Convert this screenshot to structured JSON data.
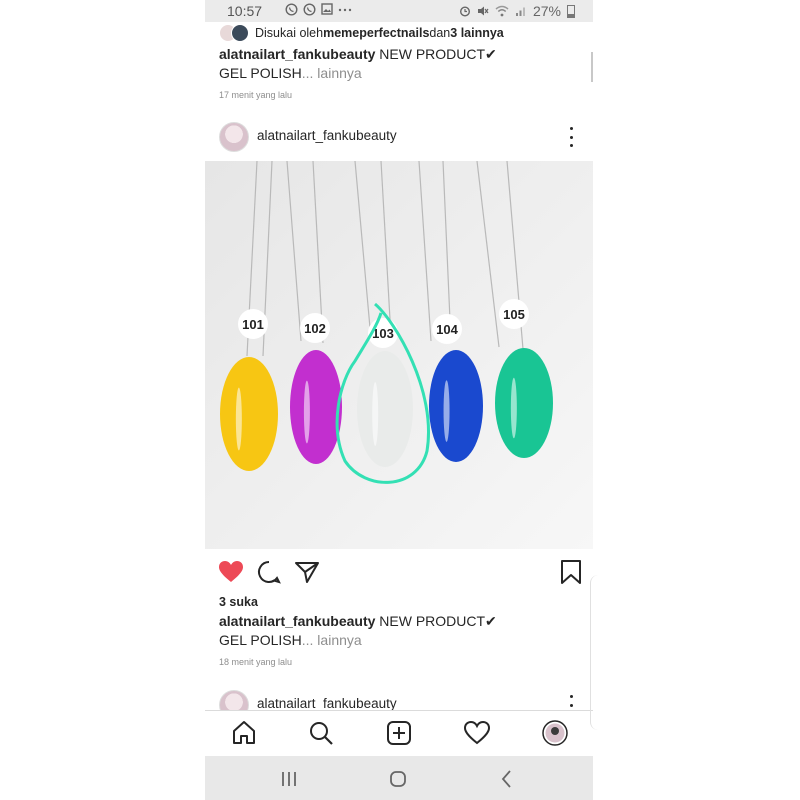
{
  "status_bar": {
    "time": "10:57",
    "battery": "27%",
    "icons_left": [
      "whatsapp-icon",
      "whatsapp-icon",
      "gallery-icon",
      "more-dots-icon"
    ],
    "icons_right": [
      "alarm-icon",
      "mute-icon",
      "wifi-icon",
      "signal-icon",
      "battery-icon"
    ]
  },
  "prev_post": {
    "likes_prefix": "Disukai oleh ",
    "likes_user": "memeperfectnails",
    "likes_mid": " dan ",
    "likes_others": "3 lainnya",
    "caption_user": "alatnailart_fankubeauty",
    "caption_text": " NEW PRODUCT✔",
    "caption_line2": "GEL POLISH",
    "caption_more": "... lainnya",
    "time_ago": "17 menit yang lalu"
  },
  "post": {
    "username": "alatnailart_fankubeauty",
    "image_alt": "nail color swatches",
    "swatches": [
      {
        "label": "101",
        "color": "#f7c613"
      },
      {
        "label": "102",
        "color": "#c22fcf"
      },
      {
        "label": "103",
        "color": "#e9ebea"
      },
      {
        "label": "104",
        "color": "#1a49cf"
      },
      {
        "label": "105",
        "color": "#19c594"
      }
    ],
    "highlight_color": "#33e0b4",
    "likes": "3 suka",
    "caption_user": "alatnailart_fankubeauty",
    "caption_text": " NEW PRODUCT✔",
    "caption_line2": "GEL POLISH",
    "caption_more": "... lainnya",
    "time_ago": "18 menit yang lalu",
    "like_color": "#ed4956"
  },
  "next_post": {
    "username": "alatnailart_fankubeauty"
  },
  "bottom_nav": [
    "home-icon",
    "search-icon",
    "add-post-icon",
    "activity-heart-icon",
    "profile-avatar"
  ],
  "system_nav": [
    "recent-apps-icon",
    "home-circle-icon",
    "back-icon"
  ]
}
